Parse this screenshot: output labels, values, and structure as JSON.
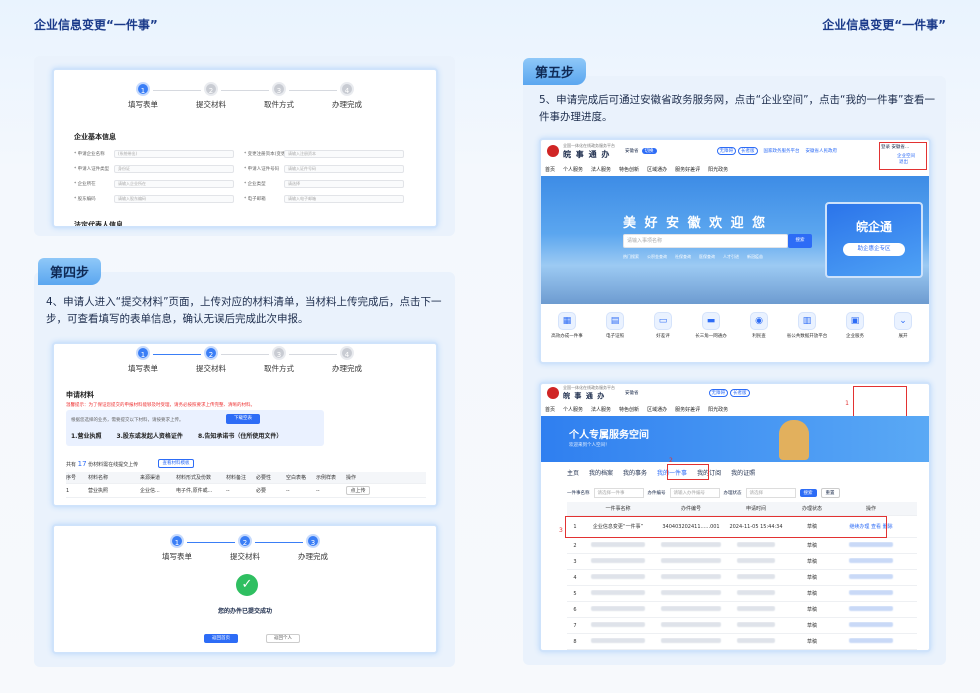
{
  "header": {
    "left": "企业信息变更“一件事”",
    "right": "企业信息变更“一件事”"
  },
  "steps4": [
    "填写表单",
    "提交材料",
    "取件方式",
    "办理完成"
  ],
  "steps3": [
    "填写表单",
    "提交材料",
    "办理完成"
  ],
  "top_form": {
    "section": "企业基本信息",
    "section2": "法定代表人信息",
    "labels": [
      "申请企业名称",
      "申请人证件类型",
      "企业所在",
      "股东编码",
      "变更注册资本(变更后)",
      "申请人证件号码",
      "企业类型",
      "电子邮箱"
    ],
    "values": [
      "(系统带出)",
      "身份证",
      "请输入企业所在",
      "请输入股东编码",
      "请输入注册资本",
      "请输入证件号码",
      "请选择",
      "请输入电子邮箱"
    ]
  },
  "step4": {
    "tag": "第四步",
    "text": "4、申请人进入“提交材料”页面，上传对应的材料清单，当材料上传完成后，点击下一步，可查看填写的表单信息，确认无误后完成此次申报。",
    "title": "申请材料",
    "warn": "温馨提示：为了保证您提交的申报材料能够及时受理，请务必按照要求上传完整、清晰的材料。",
    "box_note": "根据您选择的业务，需要提交以下材料，请按要求上传。",
    "box_btn": "下载空表",
    "items": [
      "1.营业执照",
      "3.股东或发起人资格证件",
      "8.告知承诺书（住所使用文件）"
    ],
    "count_prefix": "共有",
    "count": "17",
    "count_suffix": "份材料需在线提交上传",
    "count_btn": "查看材料模板",
    "cols": [
      "序号",
      "材料名称",
      "来源渠道",
      "材料形式及份数",
      "材料备注",
      "必要性",
      "空白表格",
      "示例样表",
      "操作"
    ],
    "row": [
      "1",
      "营业执照",
      "企业信...",
      "电子件,原件或...",
      "--",
      "必要",
      "--",
      "--",
      "点上传"
    ]
  },
  "success": {
    "msg": "您的办件已提交成功",
    "btn1": "返回首页",
    "btn2": "返回个人"
  },
  "step5": {
    "tag": "第五步",
    "text": "5、申请完成后可通过安徽省政务服务网，点击“企业空间”，点击“我的一件事”查看一件事办理进度。"
  },
  "site": {
    "small": "全国一体化在线政务服务平台",
    "name": "皖 事 通 办",
    "region": "安徽省",
    "switch": "切换",
    "links": [
      "无障碍",
      "长者版",
      "国家政务服务平台",
      "安徽省人民政府"
    ],
    "login": "登录",
    "user": "安徽省...",
    "space": "企业空间",
    "exit": "退出",
    "nav": [
      "首页",
      "个人服务",
      "法人服务",
      "特色创新",
      "区域通办",
      "服务好差评",
      "阳光政务"
    ],
    "banner": "美 好 安 徽 欢 迎 您",
    "search_ph": "请输入事项名称",
    "search_btn": "搜索",
    "hot": [
      "热门搜索",
      "公积金查询",
      "社保查询",
      "医保查询",
      "人才引进",
      "新冠疫苗"
    ],
    "promo": "皖企通",
    "promo_btn": "助企惠企专区",
    "icons": [
      "高效办成一件事",
      "电子证照",
      "好差评",
      "长三角一网通办",
      "利民查",
      "省公共数据开放平台",
      "企业服务",
      "展开"
    ]
  },
  "space": {
    "banner": "个人专属服务空间",
    "welcome": "欢迎来到个人空间！",
    "tabs": [
      "主页",
      "我的档案",
      "我的事务",
      "我的一件事",
      "我的订阅",
      "我的证照"
    ],
    "filters": [
      "一件事名称",
      "请选择一件事",
      "办件编号",
      "请输入办件编号",
      "办理状态",
      "请选择"
    ],
    "q": "搜索",
    "r": "重置",
    "cols": [
      "一件事名称",
      "办件编号",
      "申请时间",
      "办理状态",
      "操作"
    ],
    "row1": {
      "no": "1",
      "name": "企业信息变更“一件事”",
      "id": "340403202411......001",
      "time": "2024-11-05 15:44:34",
      "state": "草稿",
      "ops": "继续办理 查看 删除"
    },
    "status_other": "草稿",
    "marks": [
      "1",
      "2",
      "3"
    ]
  }
}
